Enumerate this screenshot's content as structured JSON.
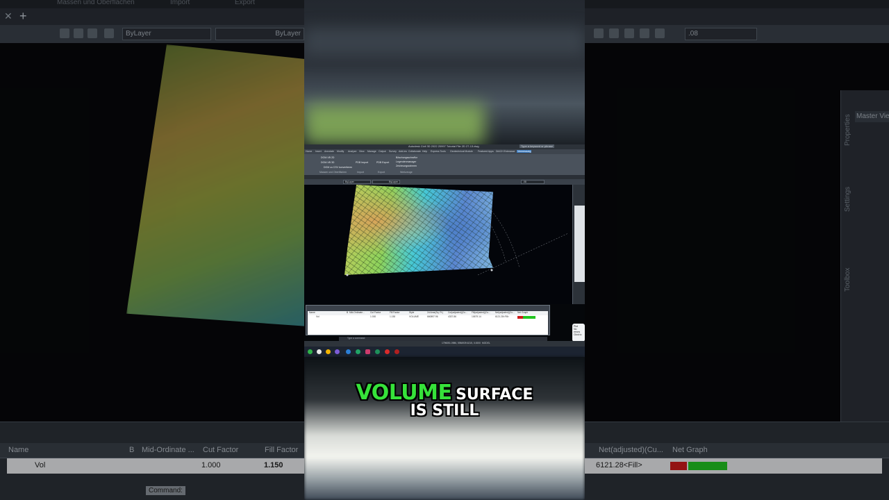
{
  "background": {
    "top_menu": [
      "Massen und Oberflächen",
      "Import",
      "Export"
    ],
    "layer_combo": "ByLayer",
    "linetype_combo": "ByLayer",
    "lineweight_combo": ".08",
    "panel_labels": [
      "Properties",
      "Settings",
      "Toolbox"
    ],
    "master_view": "Master View",
    "table_headers": [
      "Name",
      "B",
      "Mid-Ordinate ...",
      "Cut Factor",
      "Fill Factor",
      "Net(adjusted)(Cu...",
      "Net Graph"
    ],
    "row": {
      "name": "Vol",
      "cut_factor": "1.000",
      "fill_factor": "1.150",
      "net_adjusted": "6121.28<Fill>"
    },
    "command_chip": "Command:"
  },
  "video": {
    "cad": {
      "title": "Autodesk Civil 3D 2022  20997 Tutorial File 2D 27-13.dwg",
      "search": "Type a keyword or phrase",
      "ribbon_tabs": [
        "Home",
        "Insert",
        "Annotate",
        "Modify",
        "Analyze",
        "View",
        "Manage",
        "Output",
        "Survey",
        "Add-ins",
        "Collaborate",
        "Help",
        "Express Tools",
        "Geotechnical Module",
        "Featured Apps",
        "DiACH Erdmasse",
        "Vermessung"
      ],
      "active_tab": "Vermessung",
      "ribbon_items": [
        "DGM-VB 2D",
        "DGM-VB 3D",
        "DGM zu CSV konvertieren",
        "PDB Import",
        "PDB Export",
        "Böschungsschraffur",
        "Legendenmanager",
        "Zeichnungsrahmen"
      ],
      "ribbon_groups": [
        "Massen und Oberflächen",
        "Import",
        "Export",
        "Werkzeuge"
      ],
      "layer_combo": "ByLayer",
      "linetype_combo": "ByLayer",
      "lineweight_combo": ".08",
      "grid_headers": [
        "Name",
        "B",
        "Mid-Ordinate...",
        "Cut Factor",
        "Fill Factor",
        "Style",
        "2d Area(Sq. Ft.)",
        "Cut(adjusted)(Cu...",
        "Fill(adjusted)(Cu...",
        "Net(adjusted)(Cu...",
        "Net Graph"
      ],
      "grid_row": {
        "name": "Vol",
        "cut_factor": "1.000",
        "fill_factor": "1.150",
        "style": "VOLUME",
        "area": "660897.96",
        "cut": "4337.86",
        "fill": "10679.14",
        "net": "6121.28<Fill>"
      },
      "command": "Type a command",
      "status_coords": "1796051.0986, 5984939.6215, 0.0000",
      "status_model": "MODEL",
      "notify_title": "Plot",
      "notify_text": "No errors",
      "notify_link": "Click to"
    },
    "caption": {
      "highlight": "VOLUME",
      "line1_rest": "SURFACE",
      "line2": "IS STILL"
    }
  },
  "colors": {
    "caption_highlight": "#36e23a",
    "net_cut": "#cc1b1b",
    "net_fill": "#22c421",
    "ribbon_active": "#3c7bbf"
  }
}
